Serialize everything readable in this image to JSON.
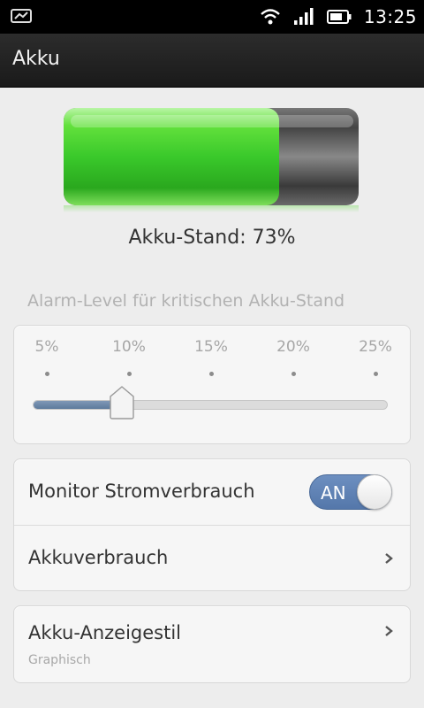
{
  "status_bar": {
    "time": "13:25",
    "icons": [
      "messenger-icon",
      "wifi-icon",
      "signal-icon",
      "battery-icon"
    ]
  },
  "action_bar": {
    "title": "Akku"
  },
  "battery": {
    "level_percent": 73,
    "status_text": "Akku-Stand: 73%",
    "fill_color": "#39c92e"
  },
  "alarm": {
    "label": "Alarm-Level für kritischen Akku-Stand",
    "ticks": [
      "5%",
      "10%",
      "15%",
      "20%",
      "25%"
    ],
    "selected": "10%",
    "selected_fraction": 0.25,
    "track_color": "#5d7a9c"
  },
  "settings": {
    "monitor_label": "Monitor Stromverbrauch",
    "monitor_toggle_text": "AN",
    "monitor_on": true,
    "usage_label": "Akkuverbrauch"
  },
  "style_setting": {
    "label": "Akku-Anzeigestil",
    "value": "Graphisch"
  },
  "colors": {
    "accent": "#5477aa",
    "background": "#ededed"
  }
}
